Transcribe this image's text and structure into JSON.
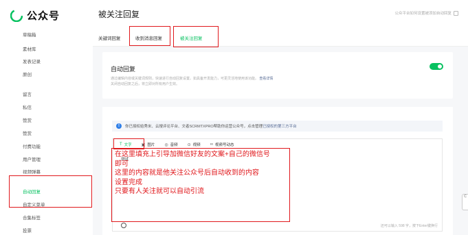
{
  "app": {
    "name": "公众号"
  },
  "sidebar": {
    "items": [
      {
        "label": "草稿箱"
      },
      {
        "label": "素材库"
      },
      {
        "label": "发表记录"
      },
      {
        "label": "原创"
      },
      {
        "label": "留言"
      },
      {
        "label": "私信"
      },
      {
        "label": "赞赏"
      },
      {
        "label": "赞赏"
      },
      {
        "label": "付费功能"
      },
      {
        "label": "用户管理"
      },
      {
        "label": "视频弹幕"
      },
      {
        "label": "自动回复",
        "active": true
      },
      {
        "label": "自定义菜单"
      },
      {
        "label": "合集标签"
      },
      {
        "label": "投票"
      }
    ]
  },
  "header": {
    "title": "被关注回复",
    "right_text": "公众平台如何设置被添加自动回复"
  },
  "tabs": [
    {
      "label": "关键词回复"
    },
    {
      "label": "收到消息回复"
    },
    {
      "label": "被关注回复",
      "active": true
    }
  ],
  "auto_reply_card": {
    "title": "自动回复",
    "desc_line1": "通过编辑内容或关键词规则，快速进行自动回复设置。如具备开发能力，可更灵活地使用该功能。",
    "desc_link": "查看详情",
    "desc_line2": "关闭自动回复之后，将立即对所有用户生效。",
    "toggle_on": true
  },
  "notice": {
    "text": "你已授权给秀米、云搜评论平台、文者SCRMTXPRO帮助你运营公众号，点击管理",
    "link": "已授权的第三方平台"
  },
  "editor": {
    "tools": [
      {
        "icon": "text-icon",
        "glyph": "T",
        "label": "文字",
        "active": true
      },
      {
        "icon": "image-icon",
        "glyph": "▣",
        "label": "图片"
      },
      {
        "icon": "audio-icon",
        "glyph": "◎",
        "label": "音频"
      },
      {
        "icon": "video-icon",
        "glyph": "⊙",
        "label": "视频"
      },
      {
        "icon": "channels-icon",
        "glyph": "∞",
        "label": "视频号动态"
      }
    ],
    "content": "测试",
    "counter": "还可以输入 598 字，按下Enter键换行"
  },
  "annotation": {
    "lines": [
      "在这里填充上引导加微信好友的文案+自己的微信号",
      "即可",
      "这里的内容就是他关注公众号后自动收到的内容",
      "设置完成",
      "只要有人关注就可以自动引流"
    ]
  },
  "edge_widget": {
    "label": "C"
  },
  "colors": {
    "accent": "#07c160",
    "annotation_red": "#e0171b",
    "link": "#576b95",
    "info": "#2f7fe8"
  }
}
